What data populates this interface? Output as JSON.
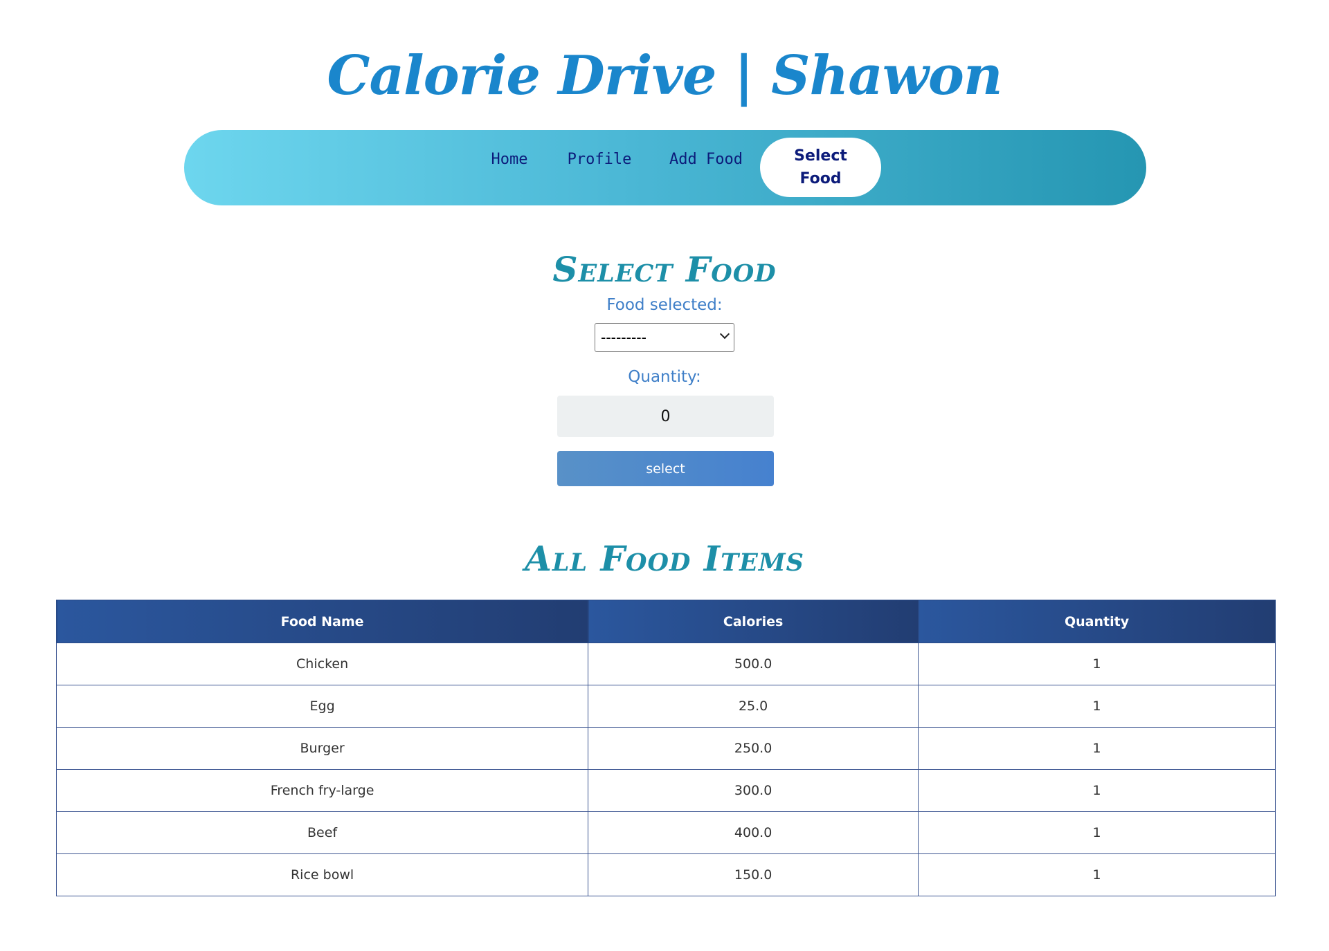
{
  "header": {
    "title": "Calorie Drive | Shawon"
  },
  "nav": {
    "items": [
      {
        "label": "Home"
      },
      {
        "label": "Profile"
      },
      {
        "label": "Add Food"
      },
      {
        "label": "Select Food",
        "active": true
      }
    ]
  },
  "select_section": {
    "heading": "Select Food",
    "food_label": "Food selected:",
    "food_value": "---------",
    "quantity_label": "Quantity:",
    "quantity_value": "0",
    "button_label": "select"
  },
  "food_items": {
    "heading": "All Food Items",
    "columns": [
      "Food Name",
      "Calories",
      "Quantity"
    ],
    "rows": [
      [
        "Chicken",
        "500.0",
        "1"
      ],
      [
        "Egg",
        "25.0",
        "1"
      ],
      [
        "Burger",
        "250.0",
        "1"
      ],
      [
        "French fry-large",
        "300.0",
        "1"
      ],
      [
        "Beef",
        "400.0",
        "1"
      ],
      [
        "Rice bowl",
        "150.0",
        "1"
      ]
    ]
  },
  "colors": {
    "title": "#1a86cc",
    "nav_gradient_start": "#6dd6ee",
    "nav_gradient_end": "#2596b2",
    "heading": "#1d8fa8",
    "label": "#3f7fc8",
    "button": "#4681cf",
    "table_header": "#2b579e"
  }
}
